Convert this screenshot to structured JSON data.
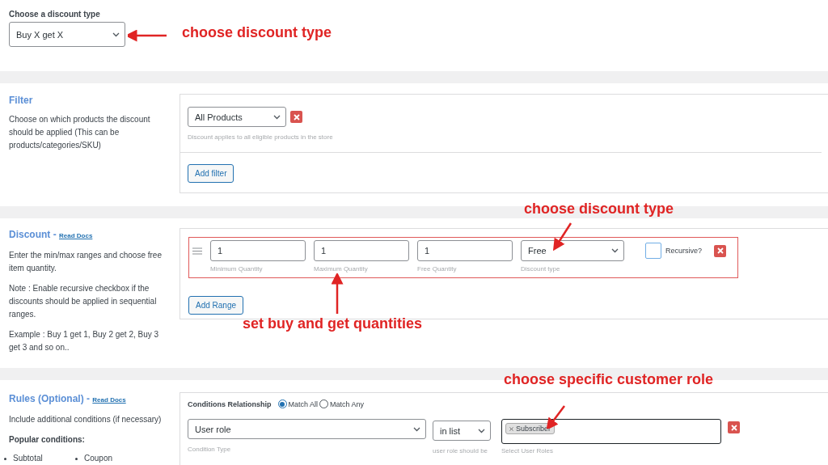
{
  "discount_type": {
    "label": "Choose a discount type",
    "value": "Buy X get X"
  },
  "filter": {
    "title": "Filter",
    "description": "Choose on which products the discount should be applied (This can be products/categories/SKU)",
    "select": "All Products",
    "hint": "Discount applies to all eligible products in the store",
    "add_button": "Add filter"
  },
  "discount": {
    "title": "Discount - ",
    "link": "Read Docs",
    "paragraphs": [
      "Enter the min/max ranges and choose free item quantity.",
      "Note : Enable recursive checkbox if the discounts should be applied in sequential ranges.",
      "Example : Buy 1 get 1, Buy 2 get 2, Buy 3 get 3 and so on.."
    ],
    "range": {
      "fields": [
        {
          "value": "1",
          "label": "Minimum Quantity"
        },
        {
          "value": "1",
          "label": "Maximum Quantity"
        },
        {
          "value": "1",
          "label": "Free Quantity"
        }
      ],
      "type_select": {
        "value": "Free",
        "label": "Discount type"
      },
      "recursive": {
        "label": "Recursive?",
        "checked": false
      }
    },
    "add_button": "Add Range"
  },
  "rules": {
    "title": "Rules (Optional) - ",
    "link": "Read Docs",
    "description": "Include additional conditions (if necessary)",
    "popular_title": "Popular conditions:",
    "popular": [
      "Subtotal",
      "Coupon"
    ],
    "relationship": {
      "label": "Conditions Relationship",
      "options": [
        {
          "label": "Match All",
          "selected": true
        },
        {
          "label": "Match Any",
          "selected": false
        }
      ]
    },
    "condition": {
      "type": {
        "value": "User role",
        "label": "Condition Type"
      },
      "operator": {
        "value": "in list",
        "label": "user role should be"
      },
      "roles": {
        "tags": [
          "Subscriber"
        ],
        "label": "Select User Roles"
      }
    }
  },
  "annotations": [
    {
      "text": "choose discount type"
    },
    {
      "text": "choose discount type"
    },
    {
      "text": "set buy and get quantities"
    },
    {
      "text": "choose specific customer role"
    }
  ]
}
